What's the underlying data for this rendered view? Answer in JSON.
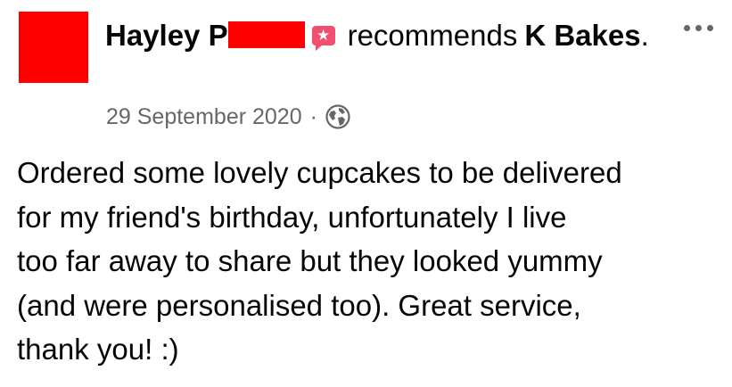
{
  "post": {
    "author_first": "Hayley P",
    "action": "recommends",
    "page_name": "K Bakes",
    "period": ".",
    "date": "29 September 2020",
    "separator": "·",
    "text": "Ordered some lovely cupcakes to be delivered\nfor my friend's birthday, unfortunately I live\ntoo far away to share but they looked yummy\n(and were personalised too). Great service,\nthank you! :)"
  },
  "icons": {
    "recommend": "recommend-star-icon",
    "privacy": "globe-icon",
    "more": "more-options-icon"
  },
  "colors": {
    "text": "#050505",
    "secondary": "#65676b",
    "recommend": "#f0506e",
    "redaction": "#ff0000"
  }
}
